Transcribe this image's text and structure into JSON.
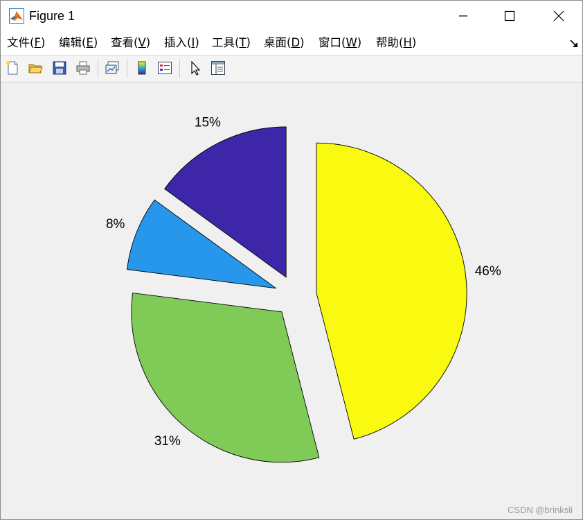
{
  "window": {
    "title": "Figure 1",
    "icon": "matlab-logo-icon"
  },
  "menubar": {
    "items": [
      {
        "text": "文件(",
        "mnemonic": "F",
        "suffix": ")"
      },
      {
        "text": "编辑(",
        "mnemonic": "E",
        "suffix": ")"
      },
      {
        "text": "查看(",
        "mnemonic": "V",
        "suffix": ")"
      },
      {
        "text": "插入(",
        "mnemonic": "I",
        "suffix": ")"
      },
      {
        "text": "工具(",
        "mnemonic": "T",
        "suffix": ")"
      },
      {
        "text": "桌面(",
        "mnemonic": "D",
        "suffix": ")"
      },
      {
        "text": "窗口(",
        "mnemonic": "W",
        "suffix": ")"
      },
      {
        "text": "帮助(",
        "mnemonic": "H",
        "suffix": ")"
      }
    ]
  },
  "toolbar": {
    "icons": [
      "new-figure-icon",
      "open-file-icon",
      "save-icon",
      "print-icon",
      "link-plot-icon",
      "insert-colorbar-icon",
      "insert-legend-icon",
      "edit-plot-arrow-icon",
      "property-inspector-icon"
    ]
  },
  "chart_data": {
    "type": "pie",
    "exploded": true,
    "slices": [
      {
        "label": "46%",
        "value": 46,
        "color": "#f9fa0f"
      },
      {
        "label": "31%",
        "value": 31,
        "color": "#80cb58"
      },
      {
        "label": "8%",
        "value": 8,
        "color": "#2797eb"
      },
      {
        "label": "15%",
        "value": 15,
        "color": "#3d26a8"
      }
    ]
  },
  "watermark": "CSDN @brinksli"
}
